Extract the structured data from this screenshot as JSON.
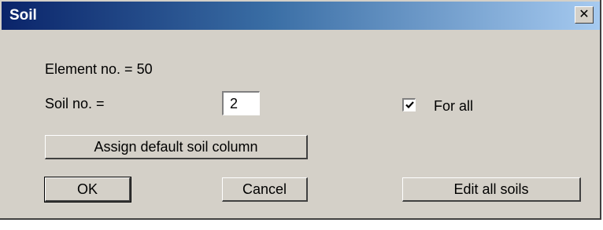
{
  "window": {
    "title": "Soil",
    "close_label": "✕"
  },
  "element": {
    "label": "Element no. = 50"
  },
  "soil": {
    "label": "Soil no. =",
    "value": "2"
  },
  "for_all": {
    "label": "For all",
    "checked": true
  },
  "buttons": {
    "assign": "Assign default soil column",
    "ok": "OK",
    "cancel": "Cancel",
    "edit_all": "Edit all soils"
  },
  "colors": {
    "titlebar_start": "#0a246a",
    "titlebar_end": "#a6caf0",
    "face": "#d4d0c8"
  }
}
